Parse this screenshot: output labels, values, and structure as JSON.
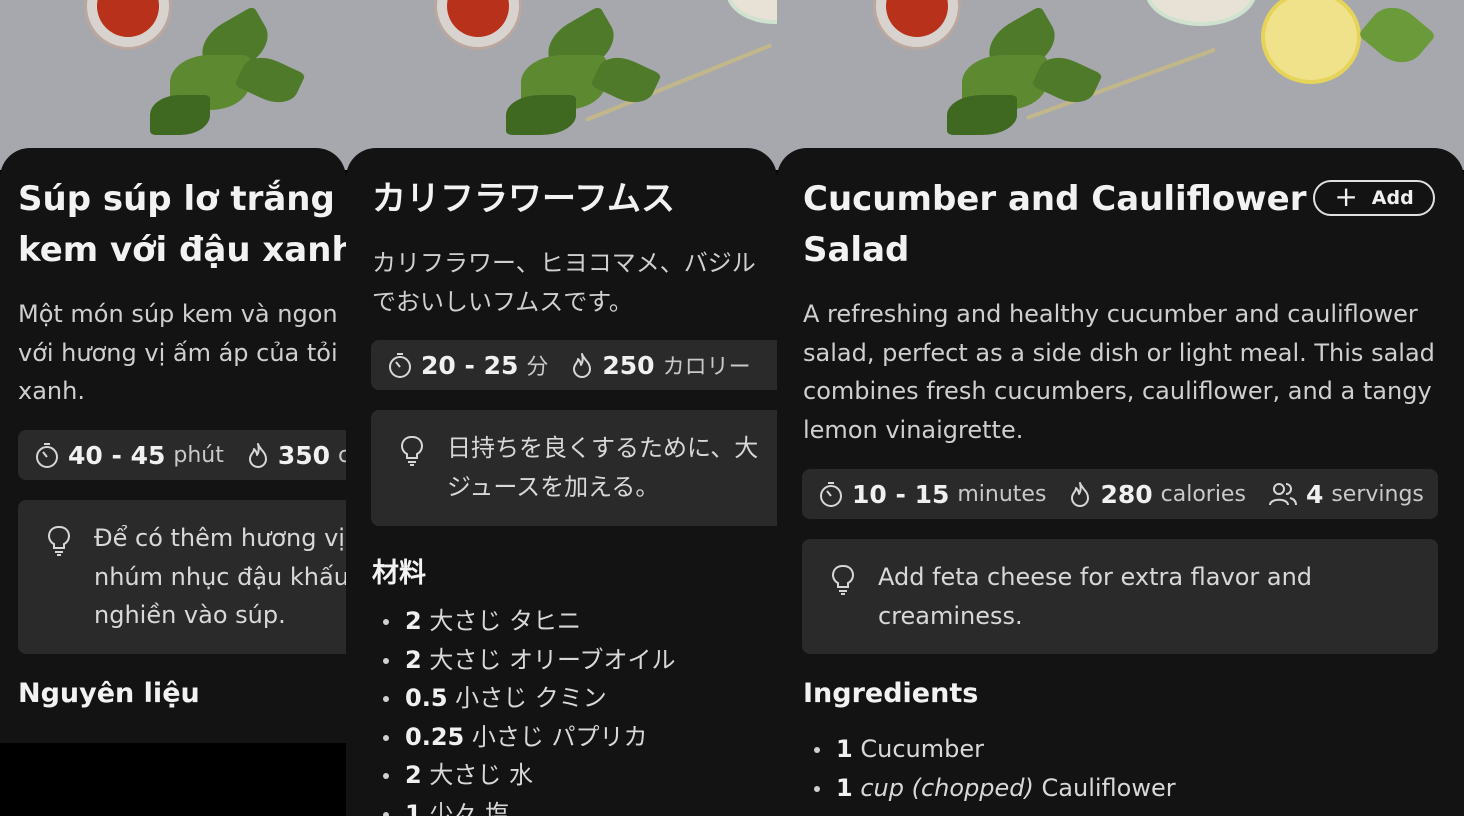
{
  "panels": [
    {
      "lang": "vi",
      "title_line1": "Súp súp lơ trắng nướng",
      "title_line2": "kem với đậu xanh",
      "desc_line1": "Một món súp kem và ngon miệng",
      "desc_line2": "với hương vị ấm áp của tỏi và đậu",
      "desc_line3": "xanh.",
      "stats": [
        {
          "icon": "timer-icon",
          "value": "40 - 45",
          "unit": "phút"
        },
        {
          "icon": "flame-icon",
          "value": "350",
          "unit": "calo"
        }
      ],
      "tip_line1": "Để có thêm hương vị, thêm một",
      "tip_line2": "nhúm nhục đậu khấu",
      "tip_line3": "nghiền vào súp.",
      "ingredients_heading": "Nguyên liệu",
      "ingredients": []
    },
    {
      "lang": "ja",
      "title_line1": "カリフラワーフムス",
      "desc_line1": "カリフラワー、ヒヨコマメ、バジル",
      "desc_line2": "でおいしいフムスです。",
      "stats": [
        {
          "icon": "timer-icon",
          "value": "20 - 25",
          "unit": "分"
        },
        {
          "icon": "flame-icon",
          "value": "250",
          "unit": "カロリー"
        }
      ],
      "tip_line1": "日持ちを良くするために、大",
      "tip_line2": "ジュースを加える。",
      "ingredients_heading": "材料",
      "ingredients": [
        {
          "qty": "2",
          "unit": "大さじ",
          "name": "タヒニ"
        },
        {
          "qty": "2",
          "unit": "大さじ",
          "name": "オリーブオイル"
        },
        {
          "qty": "0.5",
          "unit": "小さじ",
          "name": "クミン"
        },
        {
          "qty": "0.25",
          "unit": "小さじ",
          "name": "パプリカ"
        },
        {
          "qty": "2",
          "unit": "大さじ",
          "name": "水"
        },
        {
          "qty": "1",
          "unit": "少々",
          "name": "塩"
        }
      ]
    },
    {
      "lang": "en",
      "title_line1": "Cucumber and Cauliflower",
      "title_line2": "Salad",
      "add_label": "Add",
      "desc_line1": "A refreshing and healthy cucumber and cauliflower",
      "desc_line2": "salad, perfect as a side dish or light meal. This salad",
      "desc_line3": "combines fresh cucumbers, cauliflower, and a tangy",
      "desc_line4": "lemon vinaigrette.",
      "stats": [
        {
          "icon": "timer-icon",
          "value": "10 - 15",
          "unit": "minutes"
        },
        {
          "icon": "flame-icon",
          "value": "280",
          "unit": "calories"
        },
        {
          "icon": "people-icon",
          "value": "4",
          "unit": "servings"
        }
      ],
      "tip_line1": "Add feta cheese for extra flavor and",
      "tip_line2": "creaminess.",
      "ingredients_heading": "Ingredients",
      "ingredients": [
        {
          "qty": "1",
          "unit": "",
          "name": "Cucumber"
        },
        {
          "qty": "1",
          "unit": "cup (chopped)",
          "name": "Cauliflower"
        }
      ]
    }
  ]
}
